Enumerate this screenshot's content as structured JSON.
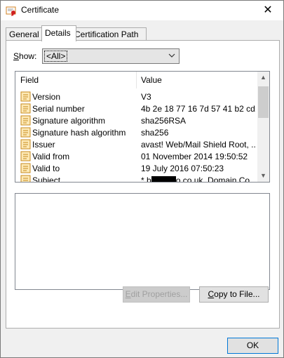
{
  "window": {
    "title": "Certificate",
    "close_glyph": "✕"
  },
  "tabs": [
    {
      "label": "General",
      "active": false
    },
    {
      "label": "Details",
      "active": true
    },
    {
      "label": "Certification Path",
      "active": false
    }
  ],
  "show": {
    "label_accel": "S",
    "label_rest": "how:",
    "selected": "<All>"
  },
  "list": {
    "columns": [
      "Field",
      "Value"
    ],
    "rows": [
      {
        "field": "Version",
        "value": "V3"
      },
      {
        "field": "Serial number",
        "value": "4b 2e 18 77 16 7d 57 41 b2 cd..."
      },
      {
        "field": "Signature algorithm",
        "value": "sha256RSA"
      },
      {
        "field": "Signature hash algorithm",
        "value": "sha256"
      },
      {
        "field": "Issuer",
        "value": "avast! Web/Mail Shield Root, ..."
      },
      {
        "field": "Valid from",
        "value": "01 November 2014 19:50:52"
      },
      {
        "field": "Valid to",
        "value": "19 July 2016 07:50:23"
      },
      {
        "field": "Subject",
        "value_prefix": "* b",
        "value_suffix": "o.co.uk, Domain Co..."
      }
    ]
  },
  "buttons": {
    "edit_properties_accel": "E",
    "edit_properties_rest": "dit Properties...",
    "copy_to_file_accel": "C",
    "copy_to_file_rest": "opy to File...",
    "ok": "OK"
  },
  "icons": {
    "title": "certificate-icon",
    "field": "certificate-field-icon",
    "dropdown": "chevron-down-icon"
  },
  "colors": {
    "accent": "#0078d7",
    "field_icon": "#f2b33d"
  }
}
